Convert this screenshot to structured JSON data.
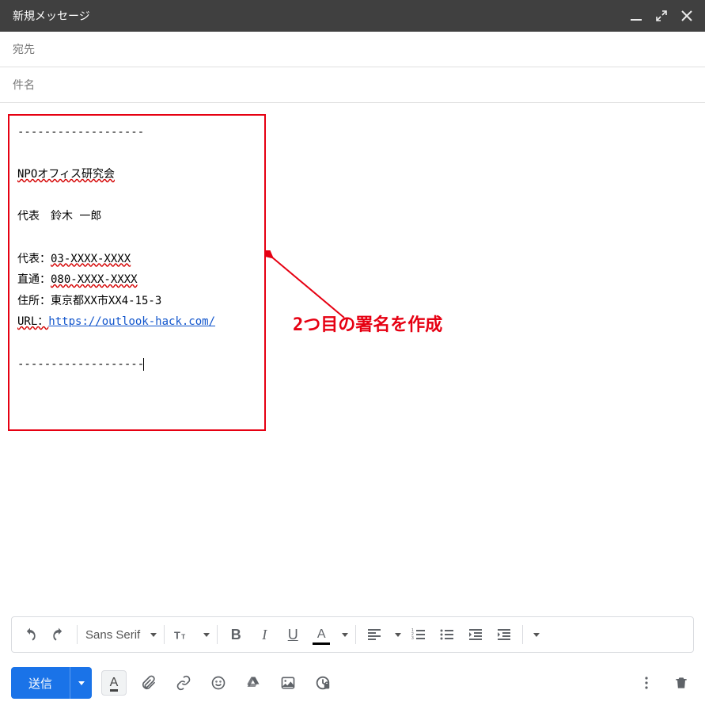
{
  "header": {
    "title": "新規メッセージ"
  },
  "fields": {
    "to_placeholder": "宛先",
    "subject_placeholder": "件名"
  },
  "signature": {
    "sep_top": "-------------------",
    "org": "NPOオフィス研究会",
    "rep_line_prefix": "代表　",
    "rep_name": "鈴木 一郎",
    "tel_main_label": "代表：",
    "tel_main_value": "03-XXXX-XXXX",
    "tel_direct_label": "直通：",
    "tel_direct_value": "080-XXXX-XXXX",
    "addr_label": "住所：",
    "addr_value": "東京都XX市XX4-15-3",
    "url_label": "URL：",
    "url_value": "https://outlook-hack.com/",
    "sep_bot": "-------------------"
  },
  "annotation": {
    "text": "2つ目の署名を作成"
  },
  "fmt": {
    "font": "Sans Serif"
  },
  "send": {
    "label": "送信"
  }
}
